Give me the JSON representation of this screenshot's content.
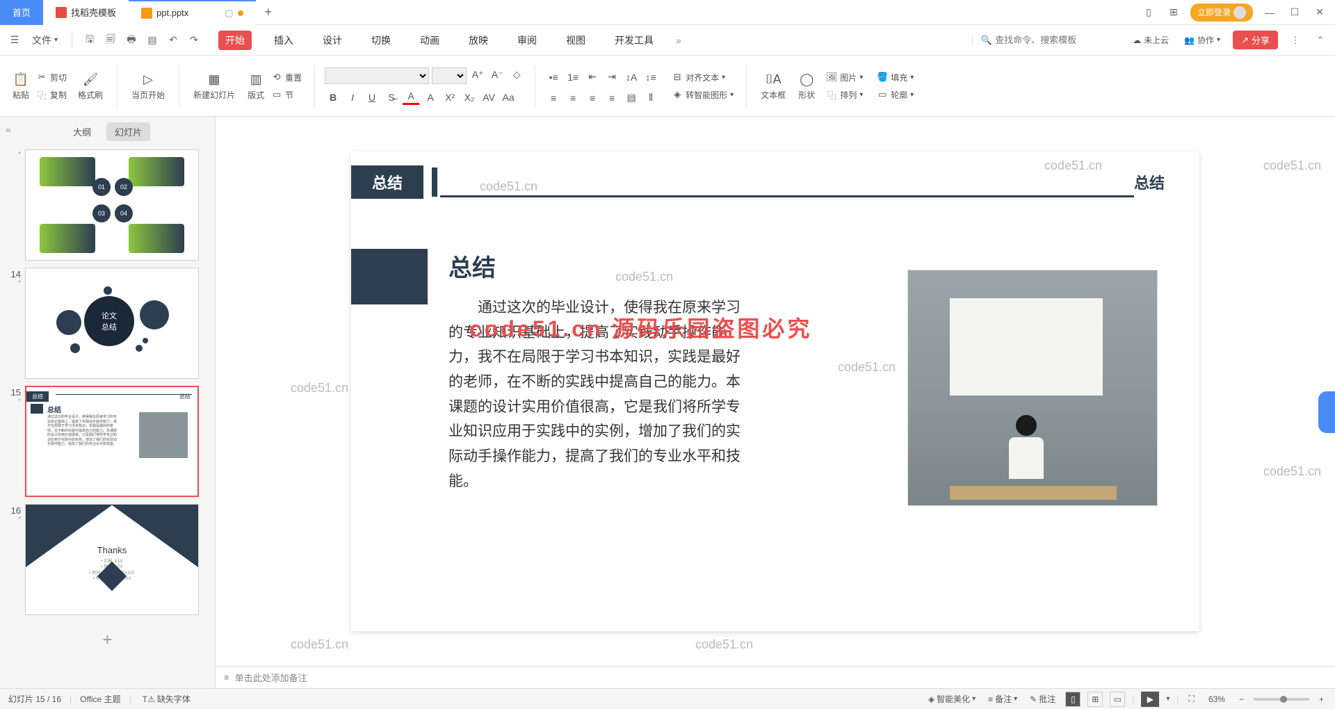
{
  "titlebar": {
    "home": "首页",
    "template": "找稻壳模板",
    "file": "ppt.pptx",
    "login": "立即登录"
  },
  "menubar": {
    "file": "文件",
    "tabs": [
      "开始",
      "插入",
      "设计",
      "切换",
      "动画",
      "放映",
      "审阅",
      "视图",
      "开发工具"
    ],
    "search_placeholder": "查找命令、搜索模板",
    "cloud": "未上云",
    "collab": "协作",
    "share": "分享"
  },
  "ribbon": {
    "paste": "粘贴",
    "cut": "剪切",
    "copy": "复制",
    "format_painter": "格式刷",
    "from_current": "当页开始",
    "new_slide": "新建幻灯片",
    "layout": "版式",
    "section": "节",
    "reset": "重置",
    "align_text": "对齐文本",
    "convert_smart": "转智能图形",
    "textbox": "文本框",
    "shape": "形状",
    "picture": "图片",
    "arrange": "排列",
    "fill": "填充",
    "outline": "轮廓"
  },
  "sidebar": {
    "outline": "大纲",
    "slides": "幻灯片",
    "nums": [
      "*",
      "14",
      "15",
      "16"
    ],
    "t14_label1": "论文",
    "t14_label2": "总结",
    "t16_thanks": "Thanks"
  },
  "slide": {
    "header_label": "总结",
    "header_right": "总结",
    "title": "总结",
    "body": "通过这次的毕业设计，使得我在原来学习的专业知识基础上，提高了实践动手操作能力，我不在局限于学习书本知识，实践是最好的老师，在不断的实践中提高自己的能力。本课题的设计实用价值很高，它是我们将所学专业知识应用于实践中的实例，增加了我们的实际动手操作能力，提高了我们的专业水平和技能。"
  },
  "watermarks": {
    "wm": "code51.cn",
    "red": "code51.cn 源码乐园盗图必究"
  },
  "notes": {
    "placeholder": "单击此处添加备注"
  },
  "statusbar": {
    "slide_pos": "幻灯片 15 / 16",
    "theme": "Office 主题",
    "missing_font": "缺失字体",
    "beautify": "智能美化",
    "notes": "备注",
    "comments": "批注",
    "zoom": "63%"
  }
}
